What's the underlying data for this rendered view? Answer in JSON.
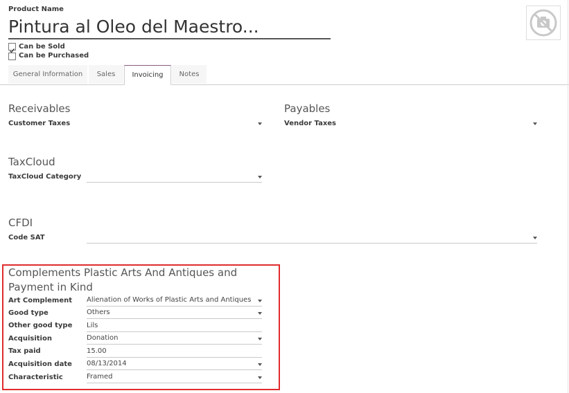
{
  "product": {
    "name_label": "Product Name",
    "name_value": "Pintura al Oleo del Maestro...",
    "can_be_sold": {
      "label": "Can be Sold",
      "checked": true
    },
    "can_be_purchased": {
      "label": "Can be Purchased",
      "checked": false
    },
    "image_icon": "no-photo-camera-icon"
  },
  "tabs": [
    {
      "label": "General Information",
      "active": false
    },
    {
      "label": "Sales",
      "active": false
    },
    {
      "label": "Invoicing",
      "active": true
    },
    {
      "label": "Notes",
      "active": false
    }
  ],
  "receivables": {
    "title": "Receivables",
    "customer_taxes_label": "Customer Taxes",
    "customer_taxes_value": ""
  },
  "payables": {
    "title": "Payables",
    "vendor_taxes_label": "Vendor Taxes",
    "vendor_taxes_value": ""
  },
  "taxcloud": {
    "title": "TaxCloud",
    "category_label": "TaxCloud Category",
    "category_value": ""
  },
  "cfdi": {
    "title": "CFDI",
    "code_sat_label": "Code SAT",
    "code_sat_value": ""
  },
  "complements": {
    "title_line1": "Complements Plastic Arts And Antiques and",
    "title_line2": "Payment in Kind",
    "highlight_color": "#e02b2b",
    "fields": [
      {
        "label": "Art Complement",
        "value": "Alienation of Works of Plastic Arts and Antiques",
        "dropdown": true
      },
      {
        "label": "Good type",
        "value": "Others",
        "dropdown": true
      },
      {
        "label": "Other good type",
        "value": "Lils",
        "dropdown": false
      },
      {
        "label": "Acquisition",
        "value": "Donation",
        "dropdown": true
      },
      {
        "label": "Tax paid",
        "value": "15.00",
        "dropdown": false
      },
      {
        "label": "Acquisition date",
        "value": "08/13/2014",
        "dropdown": true
      },
      {
        "label": "Characteristic",
        "value": "Framed",
        "dropdown": true
      }
    ]
  }
}
